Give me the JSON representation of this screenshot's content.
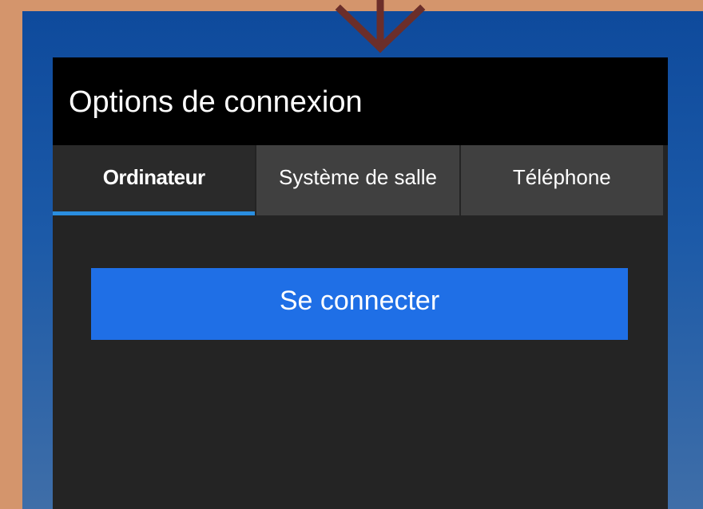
{
  "dialog": {
    "title": "Options de connexion",
    "tabs": [
      {
        "label": "Ordinateur",
        "active": true
      },
      {
        "label": "Système de salle",
        "active": false
      },
      {
        "label": "Téléphone",
        "active": false
      }
    ],
    "connect_button_label": "Se connecter"
  },
  "colors": {
    "page_background": "#d4956c",
    "backdrop_top": "#0e4a9c",
    "backdrop_bottom": "#3f6ea8",
    "header_background": "#000000",
    "panel_background": "#242424",
    "tab_background": "#404040",
    "active_tab_indicator": "#2a8ee0",
    "primary_button": "#1f6fe6",
    "annotation_arrow": "#6b2e2a"
  },
  "icons": {
    "annotation_arrow": "arrow-down-icon"
  }
}
